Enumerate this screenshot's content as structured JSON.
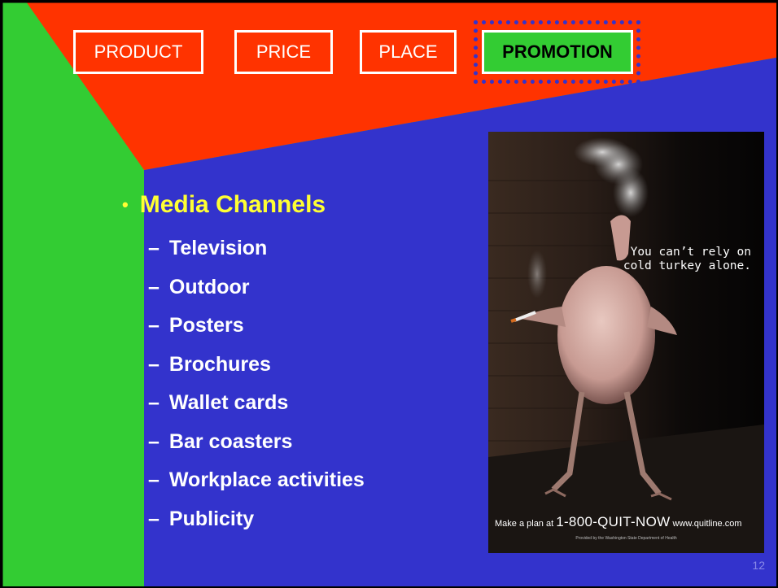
{
  "tabs": [
    {
      "label": "PRODUCT",
      "active": false
    },
    {
      "label": "PRICE",
      "active": false
    },
    {
      "label": "PLACE",
      "active": false
    },
    {
      "label": "PROMOTION",
      "active": true
    }
  ],
  "main_bullet": "Media Channels",
  "sub_bullets": [
    "Television",
    "Outdoor",
    "Posters",
    "Brochures",
    "Wallet cards",
    "Bar coasters",
    "Workplace activities",
    "Publicity"
  ],
  "poster": {
    "headline_line1": "You can’t rely on",
    "headline_line2": "cold turkey alone.",
    "cta_prefix": "Make a plan at ",
    "cta_number": "1-800-QUIT-NOW",
    "cta_url": " www.quitline.com",
    "fine_print": "Provided by the Washington State Department of Health"
  },
  "page_number": "12",
  "colors": {
    "background": "#3333cc",
    "top_band": "#ff3300",
    "left_wedge": "#33cc33",
    "heading": "#ffff33",
    "text": "#ffffff"
  }
}
